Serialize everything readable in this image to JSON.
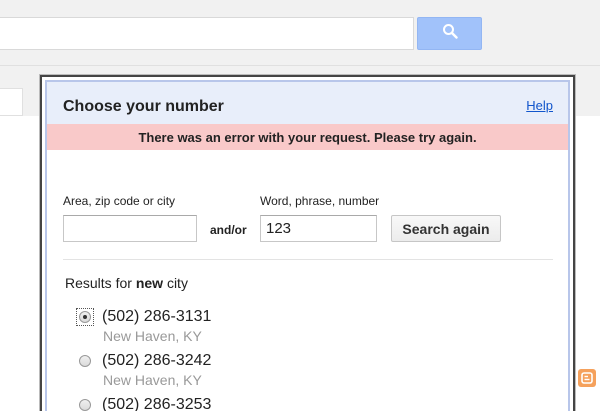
{
  "header": {
    "search_icon": "search-icon"
  },
  "dialog": {
    "title": "Choose your number",
    "help_label": "Help",
    "error_message": "There was an error with your request. Please try again."
  },
  "form": {
    "area_label": "Area, zip code or city",
    "area_value": "",
    "and_or_label": "and/or",
    "word_label": "Word, phrase, number",
    "word_value": "123",
    "search_again_label": "Search again"
  },
  "results": {
    "prefix": "Results for",
    "query": "new",
    "suffix": "city",
    "items": [
      {
        "phone": "(502) 286-3131",
        "city": "New Haven, KY",
        "selected": true
      },
      {
        "phone": "(502) 286-3242",
        "city": "New Haven, KY",
        "selected": false
      },
      {
        "phone": "(502) 286-3253",
        "city": "",
        "selected": false
      }
    ]
  },
  "colors": {
    "header_bg": "#e8eefa",
    "error_bg": "#f9c9c9",
    "link": "#1155cc",
    "search_button": "#a1c2fa"
  }
}
